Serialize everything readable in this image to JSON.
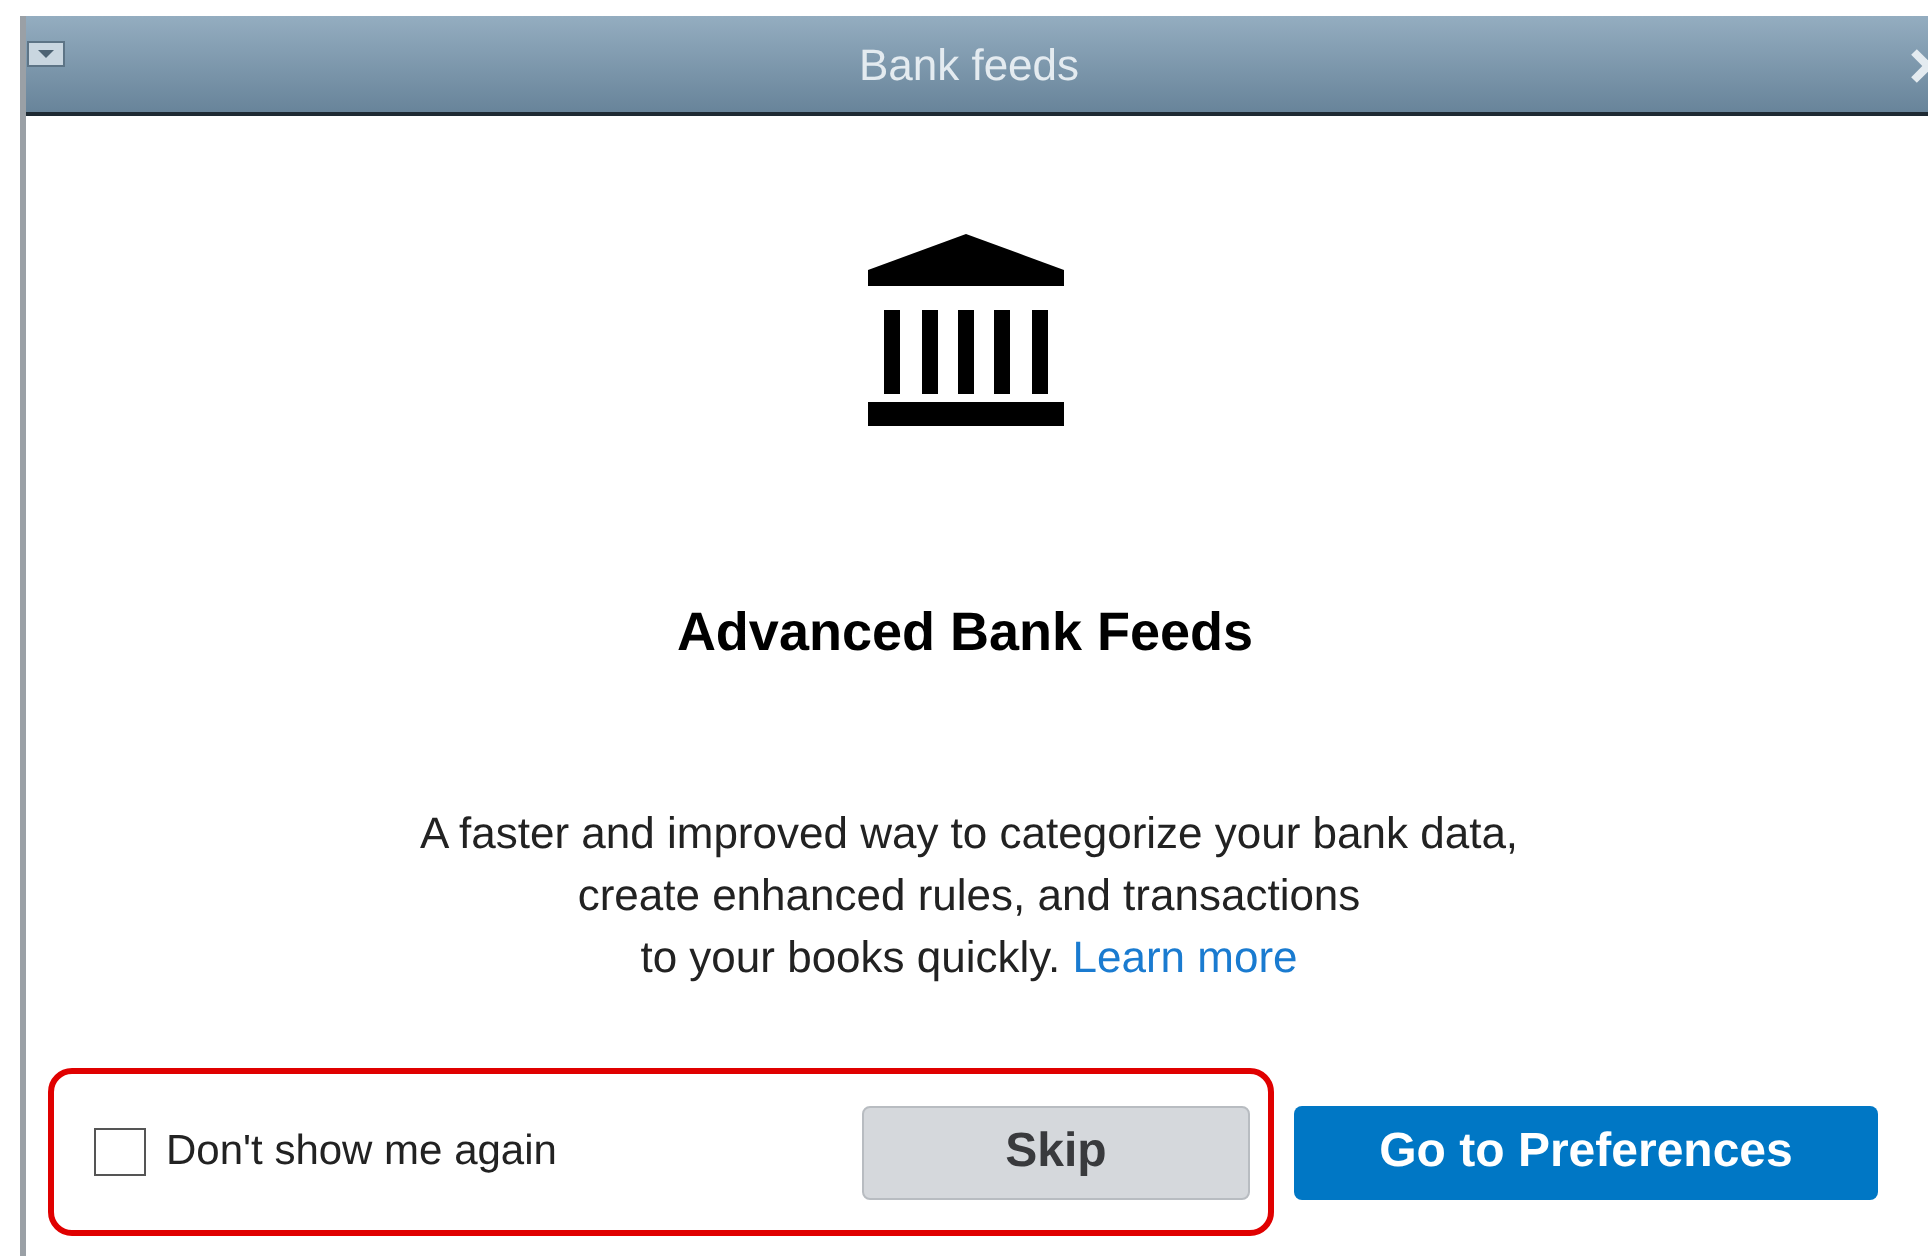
{
  "window": {
    "title": "Bank feeds"
  },
  "heading": "Advanced Bank Feeds",
  "description": [
    "A faster and improved way to categorize your bank data,",
    "create enhanced rules, and transactions",
    "to your books quickly."
  ],
  "learn_more_link": "Learn more",
  "dont_show_checkbox": {
    "label": "Don't show me again",
    "checked": false
  },
  "buttons": [
    {
      "label": "Skip",
      "kind": "secondary"
    },
    {
      "label": "Go to Preferences",
      "kind": "primary"
    }
  ]
}
